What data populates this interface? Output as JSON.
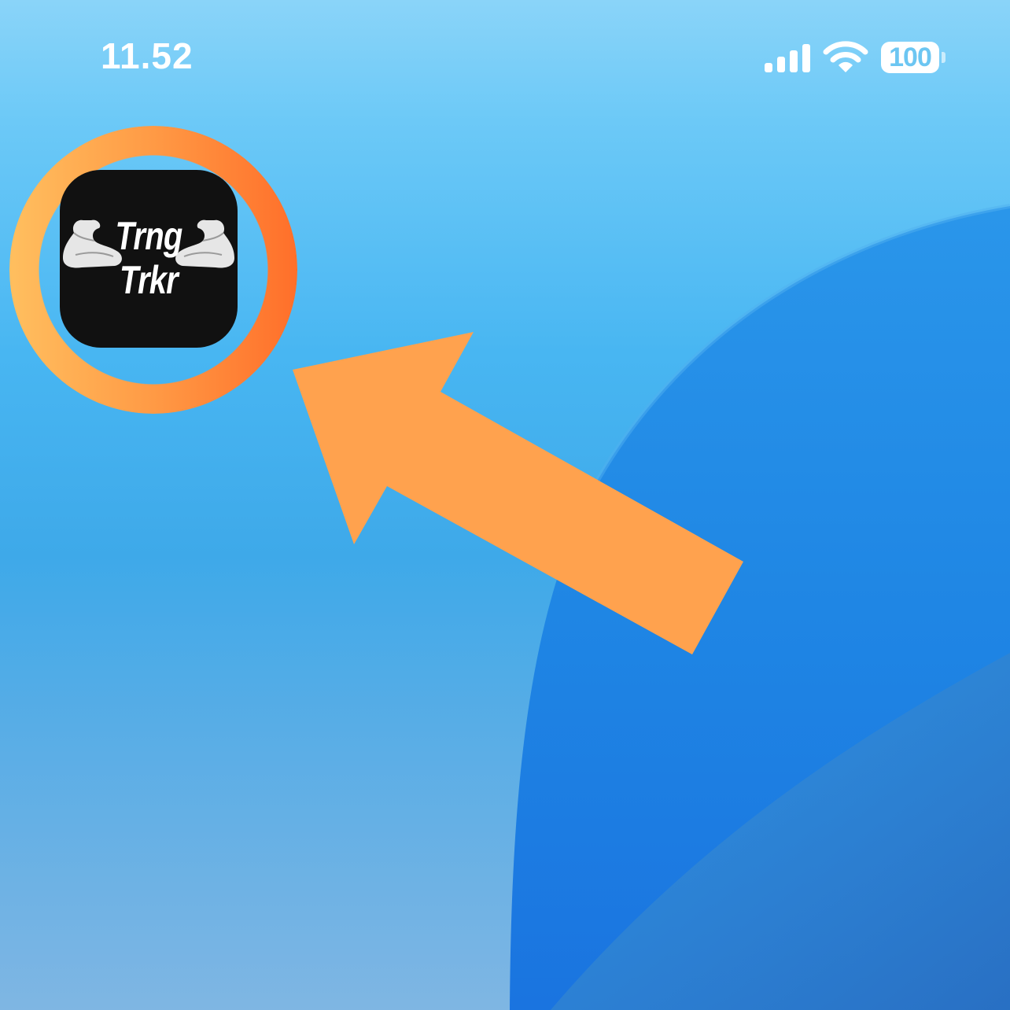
{
  "status_bar": {
    "time": "11.52",
    "battery_level": "100",
    "icons": [
      "signal-icon",
      "wifi-icon",
      "battery-icon"
    ]
  },
  "app": {
    "name_line1": "Trng",
    "name_line2": "Trkr",
    "logo": "flexing-arms-icon"
  },
  "annotation": {
    "ring_color_start": "#ffbf5f",
    "ring_color_end": "#ff6f2a",
    "arrow_color": "#ffa24e"
  },
  "colors": {
    "wallpaper_light": "#6cc9f7",
    "wallpaper_blue": "#1f86e4",
    "icon_background": "#111111"
  }
}
